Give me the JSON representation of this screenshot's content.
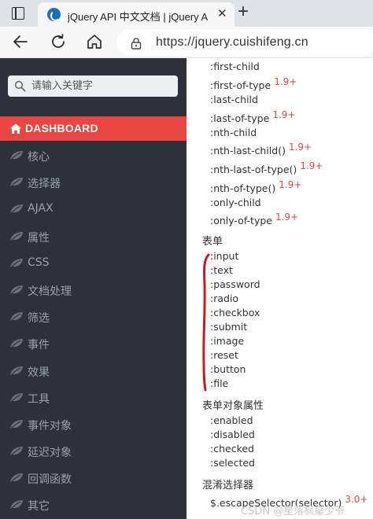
{
  "browser": {
    "tab_title": "jQuery API 中文文档 | jQuery API",
    "tab_close": "✕",
    "new_tab": "+",
    "url": "https://jquery.cuishifeng.cn"
  },
  "sidebar": {
    "search_placeholder": "请输入关键字",
    "dashboard_label": "DASHBOARD",
    "items": [
      {
        "label": "核心"
      },
      {
        "label": "选择器"
      },
      {
        "label": "AJAX"
      },
      {
        "label": "属性"
      },
      {
        "label": "CSS"
      },
      {
        "label": "文档处理"
      },
      {
        "label": "筛选"
      },
      {
        "label": "事件"
      },
      {
        "label": "效果"
      },
      {
        "label": "工具"
      },
      {
        "label": "事件对象"
      },
      {
        "label": "延迟对象"
      },
      {
        "label": "回调函数"
      },
      {
        "label": "其它"
      }
    ]
  },
  "content": {
    "items": [
      {
        "label": ":first-child",
        "version": ""
      },
      {
        "label": ":first-of-type",
        "version": "1.9+"
      },
      {
        "label": ":last-child",
        "version": ""
      },
      {
        "label": ":last-of-type",
        "version": "1.9+"
      },
      {
        "label": ":nth-child",
        "version": ""
      },
      {
        "label": ":nth-last-child()",
        "version": "1.9+"
      },
      {
        "label": ":nth-last-of-type()",
        "version": "1.9+"
      },
      {
        "label": ":nth-of-type()",
        "version": "1.9+"
      },
      {
        "label": ":only-child",
        "version": ""
      },
      {
        "label": ":only-of-type",
        "version": "1.9+"
      }
    ],
    "form_heading": "表单",
    "form_items": [
      ":input",
      ":text",
      ":password",
      ":radio",
      ":checkbox",
      ":submit",
      ":image",
      ":reset",
      ":button",
      ":file"
    ],
    "form_attr_heading": "表单对象属性",
    "form_attr_items": [
      ":enabled",
      ":disabled",
      ":checked",
      ":selected"
    ],
    "escape_heading": "混淆选择器",
    "escape_item": "$.escapeSelector(selector)",
    "escape_version": "3.0+"
  },
  "watermark": "CSDN @星落枫燊少爷",
  "colors": {
    "sidebar_bg": "#2e3139",
    "dashboard_bg": "#e84543",
    "version_red": "#e84543",
    "bracket_red": "#d4161b"
  }
}
